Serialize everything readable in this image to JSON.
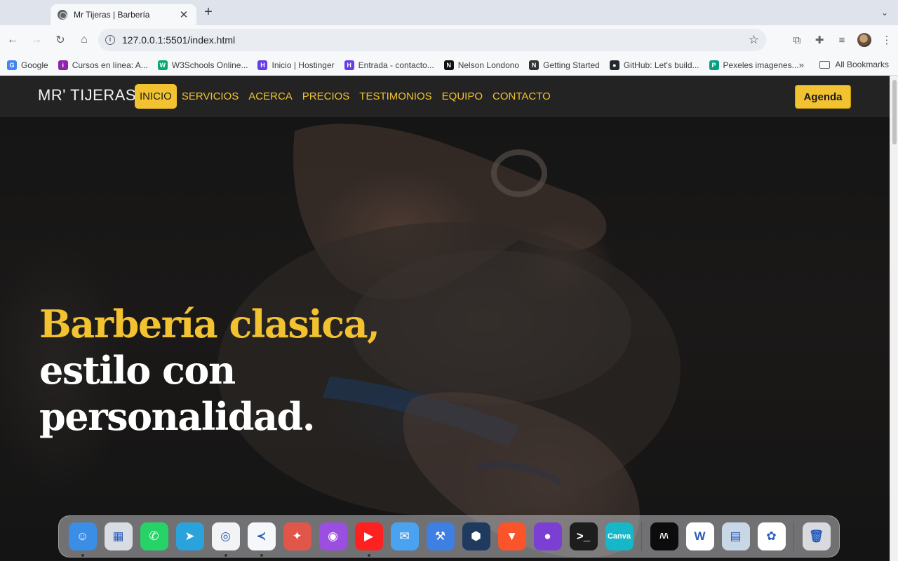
{
  "browser": {
    "tab_title": "Mr Tijeras | Barbería",
    "tab_close": "✕",
    "new_tab": "+",
    "url": "127.0.0.1:5501/index.html",
    "bookmarks": [
      {
        "label": "Google",
        "icon": "google-icon",
        "color": "#4285f4",
        "glyph": "G"
      },
      {
        "label": "Cursos en línea: A...",
        "icon": "courses-icon",
        "color": "#8e24aa",
        "glyph": "i"
      },
      {
        "label": "W3Schools Online...",
        "icon": "w3schools-icon",
        "color": "#04aa6d",
        "glyph": "W"
      },
      {
        "label": "Inicio | Hostinger",
        "icon": "hostinger-icon",
        "color": "#673de6",
        "glyph": "H"
      },
      {
        "label": "Entrada - contacto...",
        "icon": "hostinger-icon",
        "color": "#673de6",
        "glyph": "H"
      },
      {
        "label": "Nelson Londono",
        "icon": "nelson-icon",
        "color": "#111111",
        "glyph": "N"
      },
      {
        "label": "Getting Started",
        "icon": "notion-icon",
        "color": "#333333",
        "glyph": "N"
      },
      {
        "label": "GitHub: Let's build...",
        "icon": "github-icon",
        "color": "#24292f",
        "glyph": "●"
      },
      {
        "label": "Pexeles imagenes...",
        "icon": "pexels-icon",
        "color": "#05a081",
        "glyph": "P"
      }
    ],
    "bookmarks_more": "»",
    "all_bookmarks": "All Bookmarks"
  },
  "site": {
    "brand": "MR' TIJERAS",
    "nav": [
      {
        "label": "INICIO",
        "active": true
      },
      {
        "label": "SERVICIOS",
        "active": false
      },
      {
        "label": "ACERCA",
        "active": false
      },
      {
        "label": "PRECIOS",
        "active": false
      },
      {
        "label": "TESTIMONIOS",
        "active": false
      },
      {
        "label": "EQUIPO",
        "active": false
      },
      {
        "label": "CONTACTO",
        "active": false
      }
    ],
    "cta": "Agenda",
    "hero": {
      "headline_accent": "Barbería clasica,",
      "headline_rest": " estilo con personalidad."
    },
    "colors": {
      "accent": "#f2c230",
      "nav_bg": "#232323"
    }
  },
  "dock": {
    "apps": [
      {
        "name": "finder-icon",
        "color": "#3a8ee6",
        "glyph": "☺",
        "running": true
      },
      {
        "name": "launchpad-icon",
        "color": "#d9dde3",
        "glyph": "▦",
        "running": false
      },
      {
        "name": "whatsapp-icon",
        "color": "#25d366",
        "glyph": "✆",
        "running": false
      },
      {
        "name": "telegram-icon",
        "color": "#2aa3dd",
        "glyph": "➤",
        "running": false
      },
      {
        "name": "chrome-icon",
        "color": "#f1f3f4",
        "glyph": "◎",
        "running": true
      },
      {
        "name": "vscode-icon",
        "color": "#f5f7fa",
        "glyph": "≺",
        "running": true
      },
      {
        "name": "safari-icon",
        "color": "#e0574a",
        "glyph": "✦",
        "running": false
      },
      {
        "name": "podcasts-icon",
        "color": "#9b4fe0",
        "glyph": "◉",
        "running": false
      },
      {
        "name": "youtube-icon",
        "color": "#ff2020",
        "glyph": "▶",
        "running": true
      },
      {
        "name": "mail-icon",
        "color": "#4aa3f0",
        "glyph": "✉",
        "running": false
      },
      {
        "name": "xcode-icon",
        "color": "#3d7fe3",
        "glyph": "⚒",
        "running": false
      },
      {
        "name": "devtool-icon",
        "color": "#1e3a5f",
        "glyph": "⬢",
        "running": false
      },
      {
        "name": "brave-icon",
        "color": "#fb542b",
        "glyph": "▼",
        "running": false
      },
      {
        "name": "github-desktop-icon",
        "color": "#7b3fd4",
        "glyph": "●",
        "running": false
      },
      {
        "name": "terminal-icon",
        "color": "#1d1d1d",
        "glyph": ">_",
        "running": false
      },
      {
        "name": "canva-icon",
        "color": "#16b7c8",
        "glyph": "Canva",
        "running": false
      }
    ],
    "apps_after_sep": [
      {
        "name": "mongodb-compass-icon",
        "color": "#0c0c0c",
        "glyph": "/\\/\\",
        "running": false
      },
      {
        "name": "word-icon",
        "color": "#ffffff",
        "glyph": "W",
        "running": false
      },
      {
        "name": "preview-icon",
        "color": "#c9d6e6",
        "glyph": "▤",
        "running": false
      },
      {
        "name": "photos-icon",
        "color": "#ffffff",
        "glyph": "✿",
        "running": false
      }
    ],
    "trash": {
      "name": "trash-icon",
      "color": "#d8dadd",
      "glyph": "🗑"
    }
  }
}
